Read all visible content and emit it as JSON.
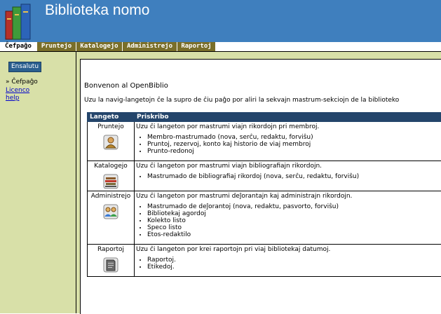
{
  "header": {
    "title": "Biblioteka nomo"
  },
  "tabs": [
    {
      "label": "Ĉefpaĝo",
      "active": true
    },
    {
      "label": "Pruntejo",
      "active": false
    },
    {
      "label": "Katalogejo",
      "active": false
    },
    {
      "label": "Administrejo",
      "active": false
    },
    {
      "label": "Raportoj",
      "active": false
    }
  ],
  "sidebar": {
    "login_button": "Ensalutu",
    "current": "» Ĉefpaĝo",
    "links": [
      "Licenco",
      "help"
    ]
  },
  "main": {
    "welcome": "Bonvenon al OpenBiblio",
    "intro": "Uzu la navig-langetojn ĉe la supro de ĉiu paĝo por aliri la sekvajn mastrum-sekciojn de la biblioteko",
    "table": {
      "headers": [
        "Langeto",
        "Priskribo"
      ],
      "rows": [
        {
          "module": "Pruntejo",
          "icon": "patron-icon",
          "description": "Uzu ĉi langeton por mastrumi viajn rikordojn pri membroj.",
          "items": [
            "Membro-mastrumado (nova, serĉu, redaktu, forviŝu)",
            "Pruntoj, rezervoj, konto kaj historio de viaj membroj",
            "Prunto-redonoj"
          ]
        },
        {
          "module": "Katalogejo",
          "icon": "books-icon",
          "description": "Uzu ĉi langeton por mastrumi viajn bibliografiajn rikordojn.",
          "items": [
            "Mastrumado de bibliografiaj rikordoj (nova, serĉu, redaktu, forviŝu)"
          ]
        },
        {
          "module": "Administrejo",
          "icon": "staff-icon",
          "description": "Uzu ĉi langeton por mastrumi deĵorantajn kaj administrajn rikordojn.",
          "items": [
            "Mastrumado de deĵorantoj (nova, redaktu, pasvorto, forviŝu)",
            "Bibliotekaj agordoj",
            "Kolekto listo",
            "Speco listo",
            "Etos-redaktilo"
          ]
        },
        {
          "module": "Raportoj",
          "icon": "report-icon",
          "description": "Uzu ĉi langeton por krei raportojn pri viaj bibliotekaj datumoj.",
          "items": [
            "Raportoj.",
            "Etikedoj."
          ]
        }
      ]
    }
  }
}
